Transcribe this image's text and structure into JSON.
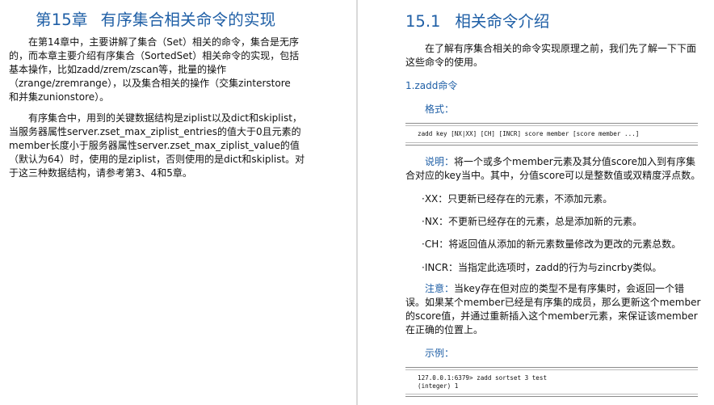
{
  "left_page": {
    "chapter_number": "第15章",
    "chapter_title": "有序集合相关命令的实现",
    "intro_lines": [
      "在第14章中，主要讲解了集合（Set）相关的命令，集合是无序",
      "的，而本章主要介绍有序集合（SortedSet）相关命令的实现，包括",
      "基本操作，比如zadd/zrem/zscan等，批量的操作",
      "（zrange/zremrange），以及集合相关的操作（交集zinterstore",
      "和并集zunionstore）。"
    ],
    "detail_lines": [
      "有序集合中，用到的关键数据结构是ziplist以及dict和skiplist，",
      "当服务器属性server.zset_max_ziplist_entries的值大于0且元素的",
      "member长度小于服务器属性server.zset_max_ziplist_value的值",
      "（默认为64）时，使用的是ziplist，否则使用的是dict和skiplist。对",
      "于这三种数据结构，请参考第3、4和5章。"
    ]
  },
  "right_page": {
    "section_number": "15.1",
    "section_title": "相关命令介绍",
    "intro_lines": [
      "在了解有序集合相关的命令实现原理之前，我们先了解一下下面",
      "这些命令的使用。"
    ],
    "subsection": "1.zadd命令",
    "format_label": "格式：",
    "syntax": "zadd key [NX|XX] [CH] [INCR] score member [score member ...]",
    "description_label": "说明：",
    "description_lines": [
      "将一个或多个member元素及其分值score加入到有序集",
      "合对应的key当中。其中，分值score可以是整数值或双精度浮点数。"
    ],
    "options": [
      "·XX：只更新已经存在的元素，不添加元素。",
      "·NX：不更新已经存在的元素，总是添加新的元素。",
      "·CH：将返回值从添加的新元素数量修改为更改的元素总数。",
      "·INCR：当指定此选项时，zadd的行为与zincrby类似。"
    ],
    "note_label": "注意：",
    "note_lines": [
      "当key存在但对应的类型不是有序集时，会返回一个错",
      "误。如果某个member已经是有序集的成员，那么更新这个member",
      "的score值，并通过重新插入这个member元素，来保证该member",
      "在正确的位置上。"
    ],
    "example_label": "示例：",
    "example_lines": [
      "127.0.0.1:6379> zadd sortset 3 test",
      "(integer) 1"
    ]
  },
  "colors": {
    "heading_blue": "#1f5fa6",
    "body_text": "#111111",
    "rule": "#8c8c8c"
  }
}
